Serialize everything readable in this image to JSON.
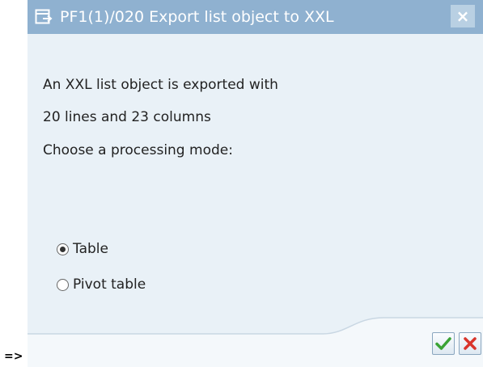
{
  "prefix": "=>",
  "dialog": {
    "title": "PF1(1)/020 Export list object to XXL",
    "close_label": "×",
    "message_lines": [
      "An XXL list object is exported with",
      "20 lines and 23 columns",
      "Choose a processing mode:"
    ],
    "options": [
      {
        "label": "Table",
        "selected": true
      },
      {
        "label": "Pivot table",
        "selected": false
      }
    ],
    "buttons": {
      "ok_icon": "green-check-icon",
      "cancel_icon": "red-x-icon"
    }
  },
  "colors": {
    "titlebar": "#8fb1d0",
    "body": "#e9f1f7",
    "ok": "#3aa335",
    "cancel": "#d9342b"
  }
}
